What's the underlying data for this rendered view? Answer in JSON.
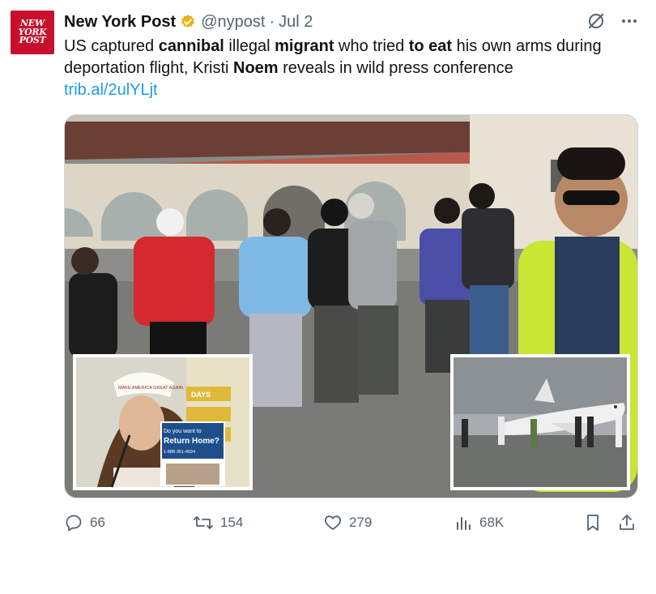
{
  "tweet": {
    "avatar_text": [
      "NEW",
      "YORK",
      "POST"
    ],
    "display_name": "New York Post",
    "handle": "@nypost",
    "separator": "·",
    "time": "Jul 2",
    "text_parts": [
      {
        "t": "US captured ",
        "bold": false
      },
      {
        "t": "cannibal",
        "bold": true
      },
      {
        "t": " illegal ",
        "bold": false
      },
      {
        "t": "migrant",
        "bold": true
      },
      {
        "t": " who tried ",
        "bold": false
      },
      {
        "t": "to eat",
        "bold": true
      },
      {
        "t": " his own arms during deportation flight, Kristi ",
        "bold": false
      },
      {
        "t": "Noem",
        "bold": true
      },
      {
        "t": " reveals in wild press conference",
        "bold": false
      }
    ],
    "link": "trib.al/2ulYLjt",
    "media": {
      "inset_left_text": {
        "cap_text": "MAKE AMERICA GREAT AGAIN",
        "sign_title": "Do you want to",
        "sign_headline": "Return Home?",
        "sign_phone": "1-888-351-4024",
        "days_label": "DAYS"
      }
    }
  },
  "actions": {
    "replies": "66",
    "reposts": "154",
    "likes": "279",
    "views": "68K"
  },
  "colors": {
    "accent_link": "#1d9bf0",
    "secondary_text": "#536471",
    "brand_red": "#c8102e",
    "verified_gold": "#e8b21c"
  }
}
